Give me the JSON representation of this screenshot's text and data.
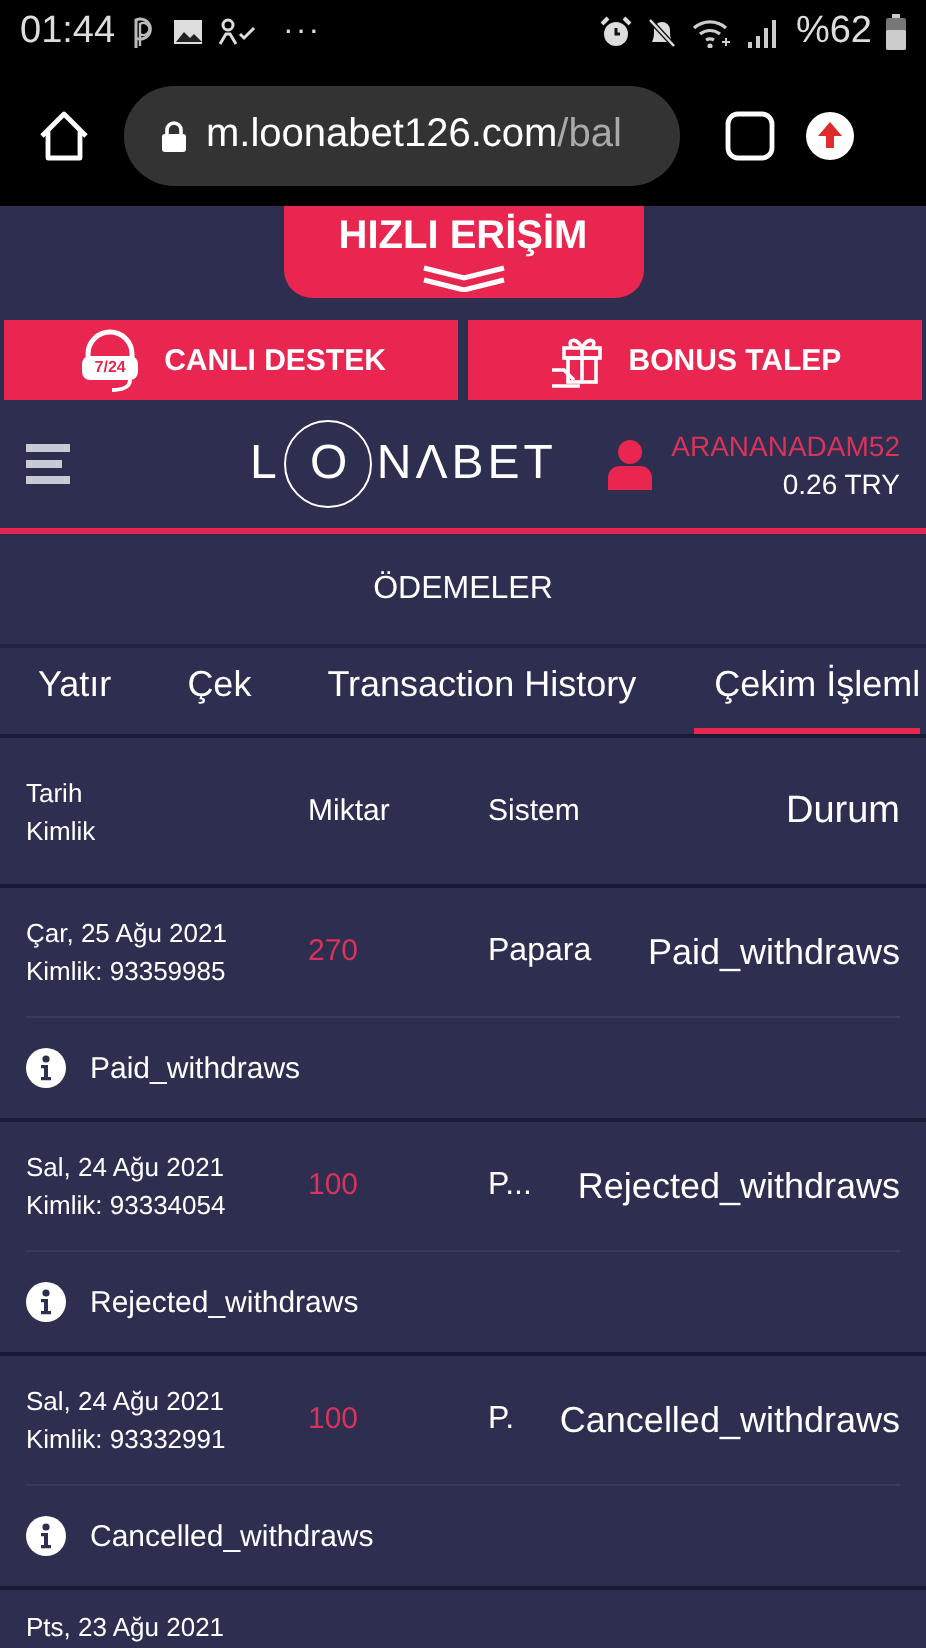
{
  "status_bar": {
    "time": "01:44",
    "overflow": "···",
    "battery": "%62"
  },
  "browser": {
    "url_host": "m.loonabet126.com",
    "url_path": "/bal"
  },
  "quick_access": {
    "label": "HIZLI ERİŞİM"
  },
  "action_buttons": [
    {
      "label": "CANLI DESTEK",
      "kind": "support",
      "badge": "7/24"
    },
    {
      "label": "BONUS TALEP",
      "kind": "gift"
    }
  ],
  "header": {
    "logo": {
      "before": "L",
      "ring": "O",
      "after": "NΛBET"
    },
    "user": {
      "name": "ARANANADAM52",
      "balance": "0.26 TRY"
    }
  },
  "page_title": "ÖDEMELER",
  "tabs": [
    {
      "label": "Yatır",
      "selected": false
    },
    {
      "label": "Çek",
      "selected": false
    },
    {
      "label": "Transaction History",
      "selected": false
    },
    {
      "label": "Çekim İşleml",
      "selected": true
    }
  ],
  "table": {
    "columns": [
      {
        "label": "Tarih",
        "sublabel": "Kimlik"
      },
      {
        "label": "Miktar"
      },
      {
        "label": "Sistem"
      },
      {
        "label": "Durum"
      }
    ],
    "rows": [
      {
        "date": "Çar, 25 Ağu 2021",
        "id": "Kimlik: 93359985",
        "amount": "270",
        "system": "Papara",
        "status": "Paid_withdraws",
        "note": "Paid_withdraws"
      },
      {
        "date": "Sal, 24 Ağu 2021",
        "id": "Kimlik: 93334054",
        "amount": "100",
        "system": "P...",
        "status": "Rejected_withdraws",
        "note": "Rejected_withdraws"
      },
      {
        "date": "Sal, 24 Ağu 2021",
        "id": "Kimlik: 93332991",
        "amount": "100",
        "system": "P.",
        "status": "Cancelled_withdraws",
        "note": "Cancelled_withdraws"
      },
      {
        "date": "Pts, 23 Ağu 2021"
      }
    ]
  }
}
